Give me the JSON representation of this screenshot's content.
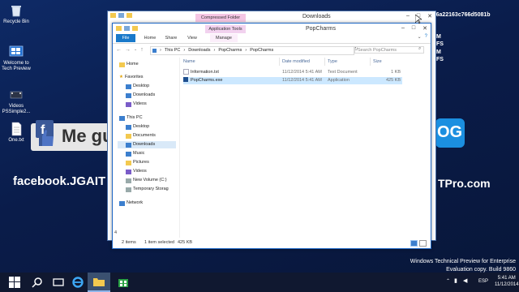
{
  "desktop": {
    "icons": [
      {
        "label": "Recycle Bin"
      },
      {
        "label": "Welcome to Tech Preview"
      },
      {
        "label": "Videos PSSimple2..."
      },
      {
        "label": "One.txt"
      }
    ],
    "hash_text": "34466a22163c766d5081b",
    "side_letters": [
      "M",
      "FS",
      "M",
      "FS"
    ],
    "banner_left": "Me gu",
    "banner_right": "OG",
    "facebook_text": "facebook.JGAIT",
    "tpro_text": "TPro.com",
    "watermark_line1": "Windows Technical Preview for Enterprise",
    "watermark_line2": "Evaluation copy. Build 9860"
  },
  "back_window": {
    "context_tab": "Compressed Folder Tools",
    "title": "Downloads"
  },
  "explorer": {
    "title": "PopCharms",
    "context_tab": "Application Tools",
    "ribbon_tabs": [
      "File",
      "Home",
      "Share",
      "View",
      "Manage"
    ],
    "breadcrumb": [
      "This PC",
      "Downloads",
      "PopCharms",
      "PopCharms"
    ],
    "search_placeholder": "Search PopCharms",
    "nav": {
      "home": "Home",
      "favorites": "Favorites",
      "fav_items": [
        "Desktop",
        "Downloads",
        "Videos"
      ],
      "this_pc": "This PC",
      "pc_items": [
        "Desktop",
        "Documents",
        "Downloads",
        "Music",
        "Pictures",
        "Videos",
        "New Volume (C:)",
        "Temporary Storag"
      ],
      "network": "Network"
    },
    "columns": [
      "Name",
      "Date modified",
      "Type",
      "Size"
    ],
    "files": [
      {
        "name": "Information.txt",
        "date": "11/12/2014 5:41 AM",
        "type": "Text Document",
        "size": "1 KB"
      },
      {
        "name": "PopCharms.exe",
        "date": "11/12/2014 5:41 AM",
        "type": "Application",
        "size": "425 KB"
      }
    ],
    "status": {
      "items": "2 items",
      "selected": "1 item selected",
      "size": "425 KB",
      "left_num": "4"
    }
  },
  "taskbar": {
    "lang": "ESP",
    "time": "5:41 AM",
    "date": "11/12/2014"
  },
  "colors": {
    "accent": "#1979ca",
    "desktop": "#0c1f4d",
    "selection": "#cce8ff",
    "compressed_tab": "#f5c6e4",
    "app_tab": "#f2d2ef"
  }
}
